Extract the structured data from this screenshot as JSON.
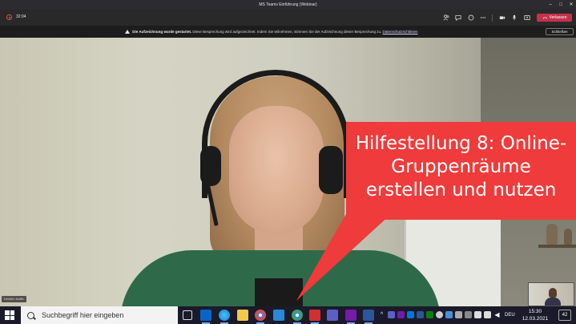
{
  "window": {
    "title": "MS Teams Einführung (Webinar)",
    "controls": [
      "–",
      "□",
      "✕"
    ]
  },
  "meeting": {
    "timer": "32:04",
    "leave_label": "Verlassen"
  },
  "banner": {
    "bold": "Die Aufzeichnung wurde gestartet.",
    "text": "Diese Besprechung wird aufgezeichnet. Indem Sie teilnehmen, stimmen Sie der Aufzeichnung dieser Besprechung zu.",
    "link": "Datenschutzrichtlinien",
    "close_label": "Schließen"
  },
  "video": {
    "caption": [
      "Hilfestellung 8: Online-",
      "Gruppenräume",
      "erstellen und nutzen"
    ],
    "name_tag": "Deutier Judith",
    "colors": {
      "caption_bg": "#ef3b3b",
      "sweater": "#2e6a4a"
    }
  },
  "taskbar": {
    "search_placeholder": "Suchbegriff hier eingeben",
    "language": "DEU",
    "time": "15:30",
    "date": "12.03.2021",
    "notifications": "42"
  }
}
